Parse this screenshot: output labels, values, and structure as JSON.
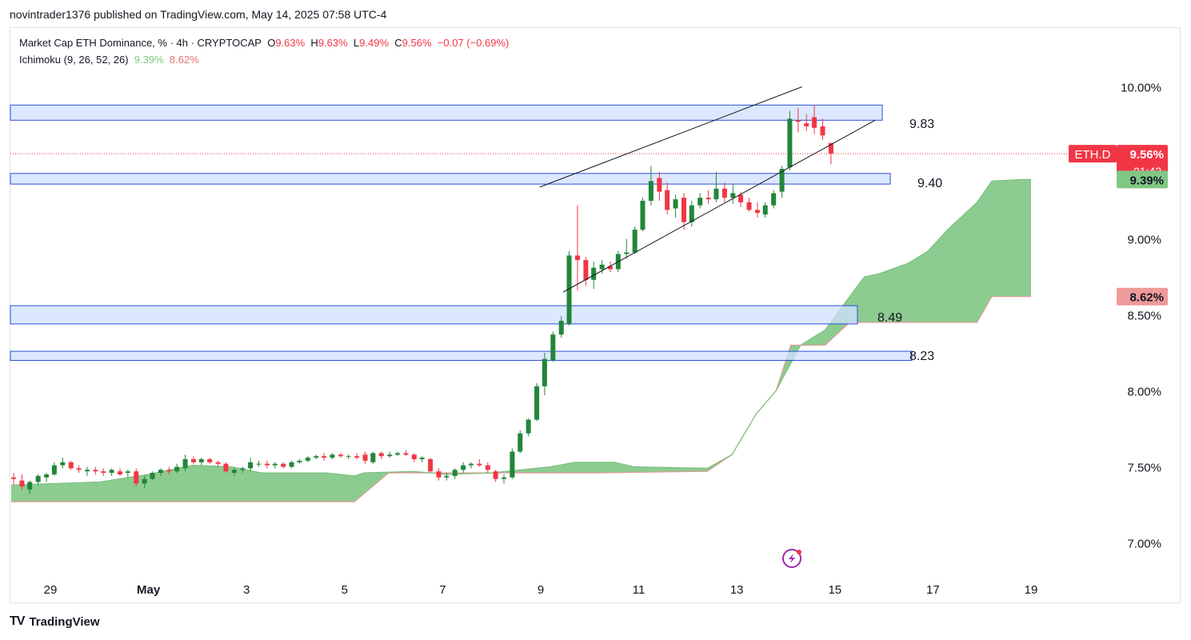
{
  "header": {
    "published": "novintrader1376 published on TradingView.com, May 14, 2025 07:58 UTC-4"
  },
  "legend": {
    "symbol": "Market Cap ETH Dominance, % · 4h · CRYPTOCAP",
    "o_label": "O",
    "o": "9.63%",
    "h_label": "H",
    "h": "9.63%",
    "l_label": "L",
    "l": "9.49%",
    "c_label": "C",
    "c": "9.56%",
    "change": "−0.07 (−0.69%)",
    "indicator": "Ichimoku (9, 26, 52, 26)",
    "ind_val1": "9.39%",
    "ind_val2": "8.62%"
  },
  "footer": {
    "brand": "TradingView",
    "logo": "TV"
  },
  "colors": {
    "up": "#22863a",
    "down": "#f23645",
    "cloud_green": "#81c784",
    "zone": "#d0e0ff",
    "zone_border": "#2b4fd8"
  },
  "chart_data": {
    "type": "candlestick",
    "symbol": "ETH.D",
    "y_ticks": [
      {
        "v": 10.0,
        "label": "10.00%"
      },
      {
        "v": 9.0,
        "label": "9.00%"
      },
      {
        "v": 8.5,
        "label": "8.50%"
      },
      {
        "v": 8.0,
        "label": "8.00%"
      },
      {
        "v": 7.5,
        "label": "7.50%"
      },
      {
        "v": 7.0,
        "label": "7.00%"
      }
    ],
    "ylim": [
      6.98,
      10.05
    ],
    "x_ticks": [
      {
        "day": 0,
        "label": "29"
      },
      {
        "day": 2,
        "label": "May"
      },
      {
        "day": 4,
        "label": "3"
      },
      {
        "day": 6,
        "label": "5"
      },
      {
        "day": 8,
        "label": "7"
      },
      {
        "day": 10,
        "label": "9"
      },
      {
        "day": 12,
        "label": "11"
      },
      {
        "day": 14,
        "label": "13"
      },
      {
        "day": 16,
        "label": "15"
      },
      {
        "day": 18,
        "label": "17"
      },
      {
        "day": 20,
        "label": "19"
      }
    ],
    "price_tags": [
      {
        "name": "ETH.D",
        "value": 9.56,
        "text": "9.56%",
        "sub": "01:42",
        "color": "#f23645"
      },
      {
        "name": "span-a",
        "value": 9.39,
        "text": "9.39%",
        "color": "#81c784"
      },
      {
        "name": "span-b",
        "value": 8.62,
        "text": "8.62%",
        "color": "#ef9a9a"
      }
    ],
    "zones": [
      {
        "top": 9.88,
        "bottom": 9.78,
        "label": "9.83"
      },
      {
        "top": 9.43,
        "bottom": 9.36,
        "label": "9.40"
      },
      {
        "top": 8.56,
        "bottom": 8.44,
        "label": "8.49"
      },
      {
        "top": 8.26,
        "bottom": 8.2,
        "label": "8.23"
      }
    ],
    "channel": [
      {
        "x1": 9.98,
        "y1": 9.34,
        "x2": 15.33,
        "y2": 10.0
      },
      {
        "x1": 10.46,
        "y1": 8.65,
        "x2": 16.82,
        "y2": 9.78
      }
    ],
    "candles": [
      {
        "x": -0.75,
        "o": 7.43,
        "h": 7.46,
        "l": 7.38,
        "c": 7.42
      },
      {
        "x": -0.58,
        "o": 7.41,
        "h": 7.45,
        "l": 7.35,
        "c": 7.37
      },
      {
        "x": -0.42,
        "o": 7.35,
        "h": 7.41,
        "l": 7.32,
        "c": 7.4
      },
      {
        "x": -0.25,
        "o": 7.4,
        "h": 7.45,
        "l": 7.38,
        "c": 7.44
      },
      {
        "x": -0.08,
        "o": 7.43,
        "h": 7.46,
        "l": 7.4,
        "c": 7.45
      },
      {
        "x": 0.08,
        "o": 7.45,
        "h": 7.53,
        "l": 7.44,
        "c": 7.51
      },
      {
        "x": 0.25,
        "o": 7.51,
        "h": 7.56,
        "l": 7.49,
        "c": 7.53
      },
      {
        "x": 0.42,
        "o": 7.53,
        "h": 7.54,
        "l": 7.48,
        "c": 7.49
      },
      {
        "x": 0.58,
        "o": 7.49,
        "h": 7.51,
        "l": 7.46,
        "c": 7.48
      },
      {
        "x": 0.75,
        "o": 7.47,
        "h": 7.5,
        "l": 7.44,
        "c": 7.48
      },
      {
        "x": 0.92,
        "o": 7.48,
        "h": 7.5,
        "l": 7.45,
        "c": 7.47
      },
      {
        "x": 1.08,
        "o": 7.47,
        "h": 7.49,
        "l": 7.44,
        "c": 7.46
      },
      {
        "x": 1.25,
        "o": 7.46,
        "h": 7.49,
        "l": 7.44,
        "c": 7.48
      },
      {
        "x": 1.42,
        "o": 7.47,
        "h": 7.49,
        "l": 7.44,
        "c": 7.45
      },
      {
        "x": 1.58,
        "o": 7.46,
        "h": 7.48,
        "l": 7.43,
        "c": 7.47
      },
      {
        "x": 1.75,
        "o": 7.47,
        "h": 7.49,
        "l": 7.37,
        "c": 7.39
      },
      {
        "x": 1.92,
        "o": 7.39,
        "h": 7.44,
        "l": 7.36,
        "c": 7.42
      },
      {
        "x": 2.08,
        "o": 7.42,
        "h": 7.47,
        "l": 7.41,
        "c": 7.46
      },
      {
        "x": 2.25,
        "o": 7.46,
        "h": 7.49,
        "l": 7.44,
        "c": 7.48
      },
      {
        "x": 2.42,
        "o": 7.48,
        "h": 7.5,
        "l": 7.45,
        "c": 7.47
      },
      {
        "x": 2.58,
        "o": 7.47,
        "h": 7.52,
        "l": 7.46,
        "c": 7.5
      },
      {
        "x": 2.75,
        "o": 7.49,
        "h": 7.58,
        "l": 7.47,
        "c": 7.55
      },
      {
        "x": 2.92,
        "o": 7.55,
        "h": 7.57,
        "l": 7.52,
        "c": 7.53
      },
      {
        "x": 3.08,
        "o": 7.53,
        "h": 7.56,
        "l": 7.51,
        "c": 7.55
      },
      {
        "x": 3.25,
        "o": 7.55,
        "h": 7.56,
        "l": 7.52,
        "c": 7.53
      },
      {
        "x": 3.42,
        "o": 7.53,
        "h": 7.54,
        "l": 7.5,
        "c": 7.52
      },
      {
        "x": 3.58,
        "o": 7.52,
        "h": 7.53,
        "l": 7.46,
        "c": 7.47
      },
      {
        "x": 3.75,
        "o": 7.46,
        "h": 7.49,
        "l": 7.44,
        "c": 7.48
      },
      {
        "x": 3.92,
        "o": 7.48,
        "h": 7.5,
        "l": 7.46,
        "c": 7.49
      },
      {
        "x": 4.08,
        "o": 7.49,
        "h": 7.56,
        "l": 7.47,
        "c": 7.53
      },
      {
        "x": 4.25,
        "o": 7.52,
        "h": 7.54,
        "l": 7.5,
        "c": 7.52
      },
      {
        "x": 4.42,
        "o": 7.52,
        "h": 7.54,
        "l": 7.49,
        "c": 7.51
      },
      {
        "x": 4.58,
        "o": 7.51,
        "h": 7.53,
        "l": 7.49,
        "c": 7.52
      },
      {
        "x": 4.75,
        "o": 7.52,
        "h": 7.53,
        "l": 7.49,
        "c": 7.5
      },
      {
        "x": 4.92,
        "o": 7.5,
        "h": 7.54,
        "l": 7.49,
        "c": 7.53
      },
      {
        "x": 5.08,
        "o": 7.53,
        "h": 7.55,
        "l": 7.52,
        "c": 7.54
      },
      {
        "x": 5.25,
        "o": 7.54,
        "h": 7.57,
        "l": 7.53,
        "c": 7.56
      },
      {
        "x": 5.42,
        "o": 7.56,
        "h": 7.58,
        "l": 7.55,
        "c": 7.57
      },
      {
        "x": 5.58,
        "o": 7.57,
        "h": 7.59,
        "l": 7.54,
        "c": 7.56
      },
      {
        "x": 5.75,
        "o": 7.56,
        "h": 7.59,
        "l": 7.55,
        "c": 7.58
      },
      {
        "x": 5.92,
        "o": 7.58,
        "h": 7.59,
        "l": 7.56,
        "c": 7.57
      },
      {
        "x": 6.08,
        "o": 7.57,
        "h": 7.58,
        "l": 7.55,
        "c": 7.57
      },
      {
        "x": 6.25,
        "o": 7.57,
        "h": 7.59,
        "l": 7.55,
        "c": 7.56
      },
      {
        "x": 6.42,
        "o": 7.58,
        "h": 7.6,
        "l": 7.52,
        "c": 7.54
      },
      {
        "x": 6.58,
        "o": 7.53,
        "h": 7.6,
        "l": 7.52,
        "c": 7.59
      },
      {
        "x": 6.75,
        "o": 7.59,
        "h": 7.6,
        "l": 7.55,
        "c": 7.57
      },
      {
        "x": 6.92,
        "o": 7.57,
        "h": 7.6,
        "l": 7.56,
        "c": 7.58
      },
      {
        "x": 7.08,
        "o": 7.58,
        "h": 7.6,
        "l": 7.57,
        "c": 7.59
      },
      {
        "x": 7.25,
        "o": 7.59,
        "h": 7.61,
        "l": 7.57,
        "c": 7.58
      },
      {
        "x": 7.42,
        "o": 7.58,
        "h": 7.59,
        "l": 7.53,
        "c": 7.55
      },
      {
        "x": 7.58,
        "o": 7.55,
        "h": 7.57,
        "l": 7.53,
        "c": 7.56
      },
      {
        "x": 7.75,
        "o": 7.55,
        "h": 7.56,
        "l": 7.46,
        "c": 7.47
      },
      {
        "x": 7.92,
        "o": 7.47,
        "h": 7.49,
        "l": 7.41,
        "c": 7.43
      },
      {
        "x": 8.08,
        "o": 7.43,
        "h": 7.46,
        "l": 7.41,
        "c": 7.44
      },
      {
        "x": 8.25,
        "o": 7.44,
        "h": 7.49,
        "l": 7.42,
        "c": 7.48
      },
      {
        "x": 8.42,
        "o": 7.48,
        "h": 7.53,
        "l": 7.46,
        "c": 7.51
      },
      {
        "x": 8.58,
        "o": 7.51,
        "h": 7.53,
        "l": 7.49,
        "c": 7.52
      },
      {
        "x": 8.75,
        "o": 7.52,
        "h": 7.55,
        "l": 7.5,
        "c": 7.51
      },
      {
        "x": 8.92,
        "o": 7.51,
        "h": 7.53,
        "l": 7.46,
        "c": 7.48
      },
      {
        "x": 9.08,
        "o": 7.47,
        "h": 7.48,
        "l": 7.4,
        "c": 7.42
      },
      {
        "x": 9.25,
        "o": 7.42,
        "h": 7.45,
        "l": 7.39,
        "c": 7.43
      },
      {
        "x": 9.42,
        "o": 7.43,
        "h": 7.62,
        "l": 7.42,
        "c": 7.6
      },
      {
        "x": 9.58,
        "o": 7.6,
        "h": 7.74,
        "l": 7.59,
        "c": 7.72
      },
      {
        "x": 9.75,
        "o": 7.72,
        "h": 7.82,
        "l": 7.7,
        "c": 7.81
      },
      {
        "x": 9.92,
        "o": 7.81,
        "h": 8.05,
        "l": 7.8,
        "c": 8.03
      },
      {
        "x": 10.08,
        "o": 8.03,
        "h": 8.25,
        "l": 7.97,
        "c": 8.21
      },
      {
        "x": 10.25,
        "o": 8.2,
        "h": 8.39,
        "l": 8.19,
        "c": 8.37
      },
      {
        "x": 10.42,
        "o": 8.37,
        "h": 8.49,
        "l": 8.35,
        "c": 8.46
      },
      {
        "x": 10.58,
        "o": 8.44,
        "h": 8.92,
        "l": 8.43,
        "c": 8.89
      },
      {
        "x": 10.75,
        "o": 8.89,
        "h": 9.22,
        "l": 8.66,
        "c": 8.86
      },
      {
        "x": 10.92,
        "o": 8.86,
        "h": 8.88,
        "l": 8.69,
        "c": 8.73
      },
      {
        "x": 11.08,
        "o": 8.73,
        "h": 8.85,
        "l": 8.67,
        "c": 8.81
      },
      {
        "x": 11.25,
        "o": 8.8,
        "h": 8.86,
        "l": 8.77,
        "c": 8.83
      },
      {
        "x": 11.42,
        "o": 8.82,
        "h": 8.85,
        "l": 8.78,
        "c": 8.8
      },
      {
        "x": 11.58,
        "o": 8.8,
        "h": 8.92,
        "l": 8.78,
        "c": 8.9
      },
      {
        "x": 11.75,
        "o": 8.9,
        "h": 9.0,
        "l": 8.87,
        "c": 8.91
      },
      {
        "x": 11.92,
        "o": 8.91,
        "h": 9.08,
        "l": 8.9,
        "c": 9.06
      },
      {
        "x": 12.08,
        "o": 9.06,
        "h": 9.27,
        "l": 9.05,
        "c": 9.25
      },
      {
        "x": 12.25,
        "o": 9.25,
        "h": 9.48,
        "l": 9.22,
        "c": 9.38
      },
      {
        "x": 12.42,
        "o": 9.4,
        "h": 9.44,
        "l": 9.25,
        "c": 9.31
      },
      {
        "x": 12.58,
        "o": 9.32,
        "h": 9.37,
        "l": 9.16,
        "c": 9.19
      },
      {
        "x": 12.75,
        "o": 9.2,
        "h": 9.29,
        "l": 9.14,
        "c": 9.26
      },
      {
        "x": 12.92,
        "o": 9.27,
        "h": 9.3,
        "l": 9.06,
        "c": 9.11
      },
      {
        "x": 13.08,
        "o": 9.11,
        "h": 9.25,
        "l": 9.08,
        "c": 9.22
      },
      {
        "x": 13.25,
        "o": 9.22,
        "h": 9.3,
        "l": 9.2,
        "c": 9.27
      },
      {
        "x": 13.42,
        "o": 9.27,
        "h": 9.32,
        "l": 9.23,
        "c": 9.26
      },
      {
        "x": 13.58,
        "o": 9.26,
        "h": 9.44,
        "l": 9.24,
        "c": 9.33
      },
      {
        "x": 13.75,
        "o": 9.33,
        "h": 9.37,
        "l": 9.24,
        "c": 9.27
      },
      {
        "x": 13.92,
        "o": 9.27,
        "h": 9.36,
        "l": 9.23,
        "c": 9.3
      },
      {
        "x": 14.08,
        "o": 9.29,
        "h": 9.31,
        "l": 9.21,
        "c": 9.24
      },
      {
        "x": 14.25,
        "o": 9.24,
        "h": 9.27,
        "l": 9.18,
        "c": 9.19
      },
      {
        "x": 14.42,
        "o": 9.19,
        "h": 9.24,
        "l": 9.14,
        "c": 9.17
      },
      {
        "x": 14.58,
        "o": 9.16,
        "h": 9.24,
        "l": 9.14,
        "c": 9.22
      },
      {
        "x": 14.75,
        "o": 9.22,
        "h": 9.32,
        "l": 9.2,
        "c": 9.3
      },
      {
        "x": 14.92,
        "o": 9.31,
        "h": 9.48,
        "l": 9.27,
        "c": 9.46
      },
      {
        "x": 15.08,
        "o": 9.47,
        "h": 9.84,
        "l": 9.45,
        "c": 9.79
      },
      {
        "x": 15.25,
        "o": 9.78,
        "h": 9.86,
        "l": 9.7,
        "c": 9.77
      },
      {
        "x": 15.42,
        "o": 9.76,
        "h": 9.82,
        "l": 9.71,
        "c": 9.74
      },
      {
        "x": 15.58,
        "o": 9.8,
        "h": 9.88,
        "l": 9.69,
        "c": 9.73
      },
      {
        "x": 15.75,
        "o": 9.74,
        "h": 9.79,
        "l": 9.65,
        "c": 9.68
      },
      {
        "x": 15.92,
        "o": 9.63,
        "h": 9.63,
        "l": 9.49,
        "c": 9.56
      }
    ],
    "cloud": {
      "span_a": [
        {
          "x": -0.8,
          "y": 7.38
        },
        {
          "x": 1.0,
          "y": 7.4
        },
        {
          "x": 2.0,
          "y": 7.45
        },
        {
          "x": 2.9,
          "y": 7.51
        },
        {
          "x": 3.7,
          "y": 7.5
        },
        {
          "x": 4.3,
          "y": 7.46
        },
        {
          "x": 5.6,
          "y": 7.46
        },
        {
          "x": 6.2,
          "y": 7.44
        },
        {
          "x": 6.4,
          "y": 7.46
        },
        {
          "x": 7.4,
          "y": 7.47
        },
        {
          "x": 8.1,
          "y": 7.45
        },
        {
          "x": 9.0,
          "y": 7.46
        },
        {
          "x": 10.2,
          "y": 7.5
        },
        {
          "x": 10.7,
          "y": 7.53
        },
        {
          "x": 11.5,
          "y": 7.53
        },
        {
          "x": 11.9,
          "y": 7.5
        },
        {
          "x": 13.4,
          "y": 7.49
        },
        {
          "x": 13.9,
          "y": 7.58
        },
        {
          "x": 14.4,
          "y": 7.85
        },
        {
          "x": 14.8,
          "y": 8.0
        },
        {
          "x": 15.3,
          "y": 8.3
        },
        {
          "x": 15.8,
          "y": 8.4
        },
        {
          "x": 16.3,
          "y": 8.62
        },
        {
          "x": 16.6,
          "y": 8.75
        },
        {
          "x": 16.9,
          "y": 8.77
        },
        {
          "x": 17.5,
          "y": 8.84
        },
        {
          "x": 17.9,
          "y": 8.92
        },
        {
          "x": 18.3,
          "y": 9.06
        },
        {
          "x": 18.6,
          "y": 9.15
        },
        {
          "x": 18.9,
          "y": 9.24
        },
        {
          "x": 19.2,
          "y": 9.38
        },
        {
          "x": 19.8,
          "y": 9.39
        },
        {
          "x": 20.0,
          "y": 9.39
        }
      ],
      "span_b": [
        {
          "x": -0.8,
          "y": 7.27
        },
        {
          "x": 2.6,
          "y": 7.27
        },
        {
          "x": 6.2,
          "y": 7.27
        },
        {
          "x": 6.9,
          "y": 7.46
        },
        {
          "x": 11.2,
          "y": 7.46
        },
        {
          "x": 13.4,
          "y": 7.47
        },
        {
          "x": 13.9,
          "y": 7.58
        },
        {
          "x": 14.4,
          "y": 7.85
        },
        {
          "x": 14.8,
          "y": 8.0
        },
        {
          "x": 15.1,
          "y": 8.3
        },
        {
          "x": 15.8,
          "y": 8.3
        },
        {
          "x": 16.3,
          "y": 8.45
        },
        {
          "x": 18.9,
          "y": 8.45
        },
        {
          "x": 19.2,
          "y": 8.62
        },
        {
          "x": 20.0,
          "y": 8.62
        }
      ]
    }
  }
}
